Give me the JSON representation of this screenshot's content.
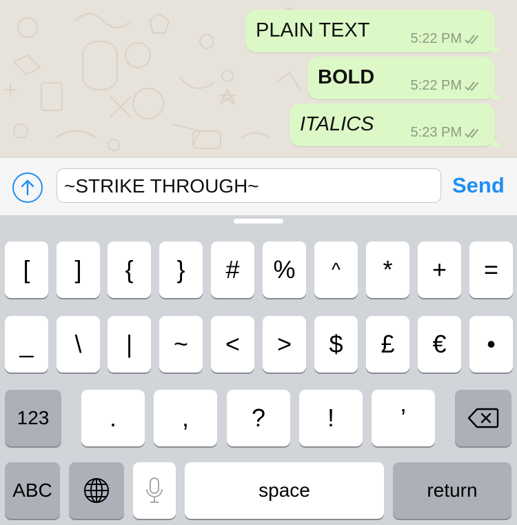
{
  "messages": [
    {
      "text": "PLAIN TEXT",
      "time": "5:22 PM"
    },
    {
      "text": "BOLD",
      "time": "5:22 PM"
    },
    {
      "text": "ITALICS",
      "time": "5:23 PM"
    }
  ],
  "composer": {
    "input_value": "~STRIKE THROUGH~",
    "send_label": "Send"
  },
  "keyboard": {
    "row1": [
      "[",
      "]",
      "{",
      "}",
      "#",
      "%",
      "^",
      "*",
      "+",
      "="
    ],
    "row2": [
      "_",
      "\\",
      "|",
      "~",
      "<",
      ">",
      "$",
      "£",
      "€",
      "•"
    ],
    "row3": {
      "mode_key": "123",
      "keys": [
        ".",
        ",",
        "?",
        "!",
        "’"
      ],
      "delete_icon": "backspace-icon"
    },
    "row4": {
      "abc_key": "ABC",
      "globe_icon": "globe-icon",
      "mic_icon": "microphone-icon",
      "space": "space",
      "return": "return"
    }
  },
  "colors": {
    "bubble": "#dcf8c6",
    "chat_bg": "#e7e2da",
    "send": "#1e8ef2",
    "keyboard_bg": "#d1d4d9"
  }
}
